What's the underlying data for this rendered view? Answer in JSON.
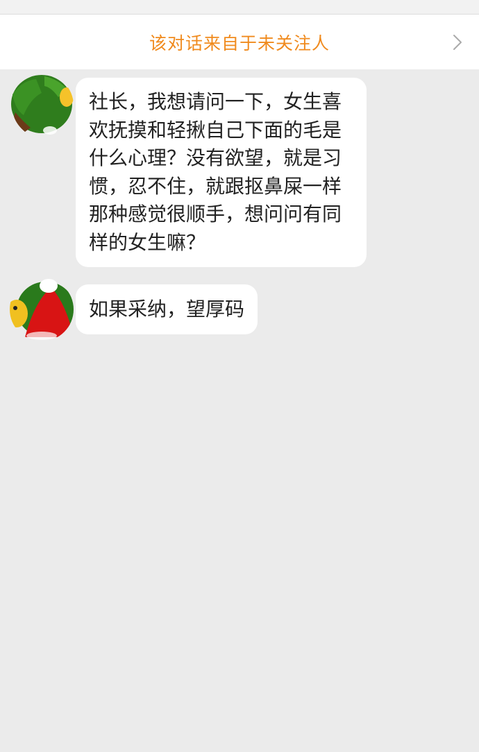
{
  "header": {
    "notice_text": "该对话来自于未关注人",
    "chevron_icon": "chevron-right-icon"
  },
  "messages": [
    {
      "text": "社长，我想请问一下，女生喜欢抚摸和轻揪自己下面的毛是什么心理？没有欲望，就是习惯，忍不住，就跟抠鼻屎一样那种感觉很顺手，想问问有同样的女生嘛？",
      "avatar_icon": "sender-avatar"
    },
    {
      "text": "如果采纳，望厚码",
      "avatar_icon": "sender-avatar"
    }
  ],
  "colors": {
    "accent": "#f08a1d",
    "background": "#ebebeb",
    "bubble": "#ffffff"
  }
}
